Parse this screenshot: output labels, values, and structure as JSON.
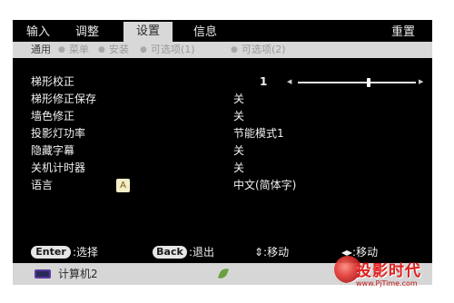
{
  "tabs": [
    {
      "label": "输入",
      "active": false
    },
    {
      "label": "调整",
      "active": false
    },
    {
      "label": "设置",
      "active": true
    },
    {
      "label": "信息",
      "active": false
    }
  ],
  "reset_label": "重置",
  "subtabs": [
    {
      "label": "通用",
      "active": true
    },
    {
      "label": "菜单",
      "active": false
    },
    {
      "label": "安装",
      "active": false
    },
    {
      "label": "可选项(1)",
      "active": false
    },
    {
      "label": "可选项(2)",
      "active": false
    }
  ],
  "menu": {
    "keystone": {
      "label": "梯形校正",
      "value": "1",
      "slider_fraction": 0.6
    },
    "items": [
      {
        "label": "梯形修正保存",
        "value": "关"
      },
      {
        "label": "墙色修正",
        "value": "关"
      },
      {
        "label": "投影灯功率",
        "value": "节能模式1"
      },
      {
        "label": "隐藏字幕",
        "value": "关"
      },
      {
        "label": "关机计时器",
        "value": "关"
      },
      {
        "label": "语言",
        "value": "中文(简体字)"
      }
    ]
  },
  "hints": {
    "enter_key": "Enter",
    "select": ":选择",
    "back_key": "Back",
    "exit": ":退出",
    "move_updown": "⇕:移动",
    "move_leftright": "◂▸:移动"
  },
  "source": {
    "label": "计算机2"
  },
  "watermark": {
    "brand": "投影时代",
    "url": "www.PjTime.com"
  },
  "colors": {
    "screen_bg": "#000000",
    "active_tab": "#d8d8d8",
    "text": "#f2f2f2",
    "watermark": "#e02020"
  }
}
